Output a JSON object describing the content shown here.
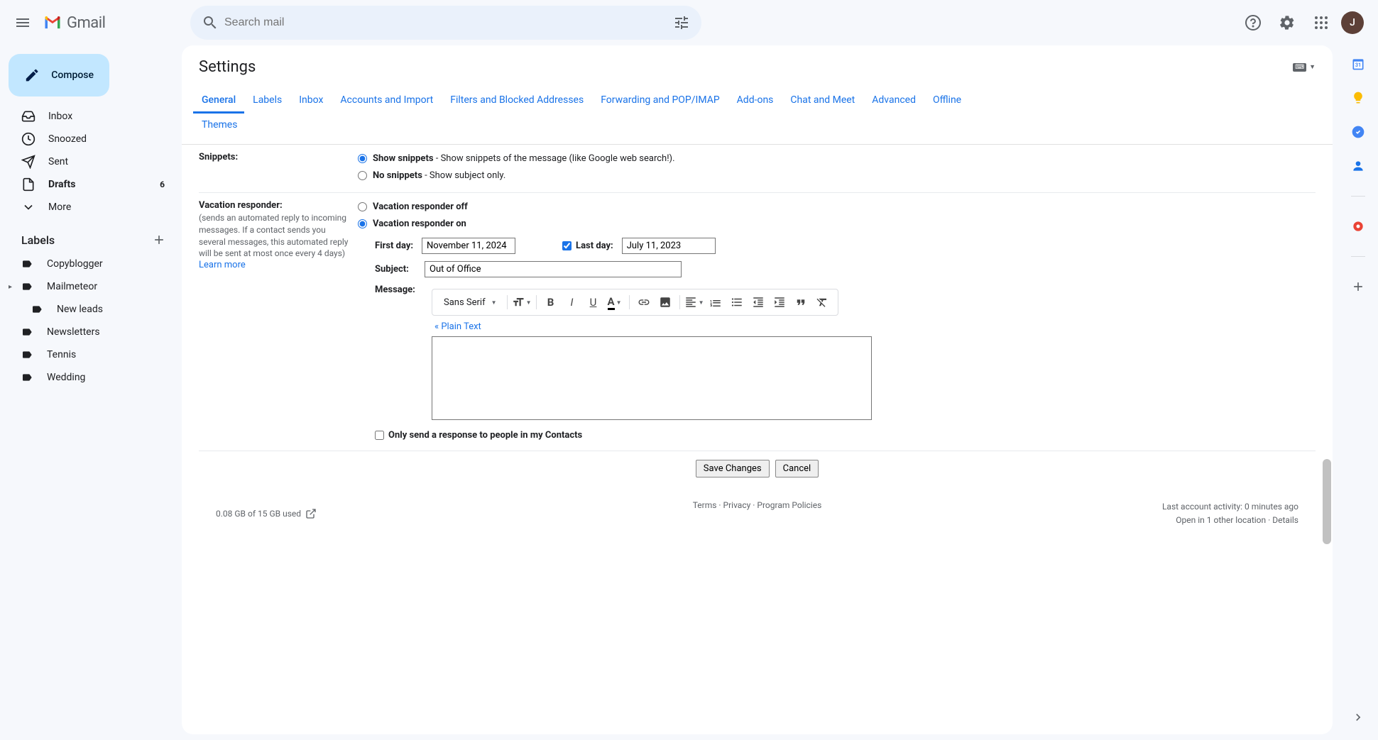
{
  "header": {
    "logo_text": "Gmail",
    "search_placeholder": "Search mail",
    "avatar_initial": "J"
  },
  "compose_label": "Compose",
  "nav": [
    {
      "label": "Inbox",
      "icon": "inbox",
      "bold": false,
      "count": ""
    },
    {
      "label": "Snoozed",
      "icon": "clock",
      "bold": false,
      "count": ""
    },
    {
      "label": "Sent",
      "icon": "send",
      "bold": false,
      "count": ""
    },
    {
      "label": "Drafts",
      "icon": "file",
      "bold": true,
      "count": "6"
    },
    {
      "label": "More",
      "icon": "chevron-down",
      "bold": false,
      "count": ""
    }
  ],
  "labels_header": "Labels",
  "labels": [
    {
      "label": "Copyblogger",
      "nested": false,
      "expandable": false
    },
    {
      "label": "Mailmeteor",
      "nested": false,
      "expandable": true
    },
    {
      "label": "New leads",
      "nested": true,
      "expandable": false
    },
    {
      "label": "Newsletters",
      "nested": false,
      "expandable": false
    },
    {
      "label": "Tennis",
      "nested": false,
      "expandable": false
    },
    {
      "label": "Wedding",
      "nested": false,
      "expandable": false
    }
  ],
  "settings": {
    "title": "Settings",
    "tabs": [
      "General",
      "Labels",
      "Inbox",
      "Accounts and Import",
      "Filters and Blocked Addresses",
      "Forwarding and POP/IMAP",
      "Add-ons",
      "Chat and Meet",
      "Advanced",
      "Offline"
    ],
    "tabs_row2": [
      "Themes"
    ],
    "active_tab": "General",
    "snippets": {
      "label": "Snippets:",
      "options": [
        {
          "bold": "Show snippets",
          "rest": " - Show snippets of the message (like Google web search!).",
          "checked": true
        },
        {
          "bold": "No snippets",
          "rest": " - Show subject only.",
          "checked": false
        }
      ]
    },
    "vacation": {
      "label": "Vacation responder:",
      "desc": "(sends an automated reply to incoming messages. If a contact sends you several messages, this automated reply will be sent at most once every 4 days)",
      "learn_more": "Learn more",
      "options": [
        {
          "label": "Vacation responder off",
          "checked": false
        },
        {
          "label": "Vacation responder on",
          "checked": true
        }
      ],
      "first_day_label": "First day:",
      "first_day_value": "November 11, 2024",
      "last_day_checked": true,
      "last_day_label": "Last day:",
      "last_day_value": "July 11, 2023",
      "subject_label": "Subject:",
      "subject_value": "Out of Office",
      "message_label": "Message:",
      "font_name": "Sans Serif",
      "plain_text": "« Plain Text",
      "message_value": "",
      "contacts_only_checked": false,
      "contacts_only_label": "Only send a response to people in my Contacts"
    },
    "save_label": "Save Changes",
    "cancel_label": "Cancel"
  },
  "footer": {
    "storage": "0.08 GB of 15 GB used",
    "terms": "Terms",
    "privacy": "Privacy",
    "policies": "Program Policies",
    "activity": "Last account activity: 0 minutes ago",
    "open_in": "Open in 1 other location",
    "details": "Details"
  }
}
